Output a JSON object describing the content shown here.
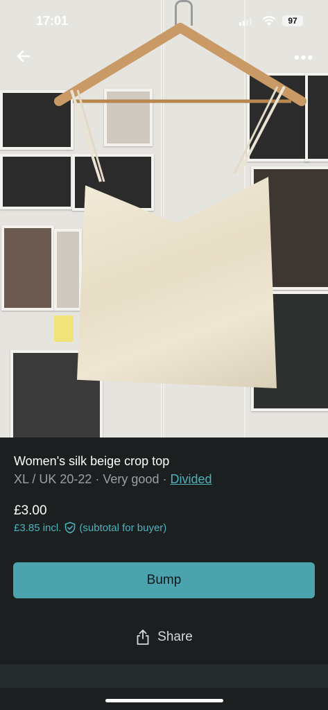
{
  "status_bar": {
    "time": "17:01",
    "battery": "97"
  },
  "nav": {
    "back_icon": "arrow-left-icon",
    "more_label": "•••"
  },
  "item": {
    "title": "Women's silk beige crop top",
    "size": "XL / UK 20-22",
    "separator": " · ",
    "condition": "Very good",
    "brand": "Divided",
    "price": "£3.00",
    "price_incl": "£3.85 incl.",
    "buyer_note": "(subtotal for buyer)"
  },
  "actions": {
    "bump_label": "Bump",
    "share_label": "Share"
  },
  "colors": {
    "accent": "#4eb3bd",
    "button": "#4aa3ad",
    "background": "#1b1f20"
  }
}
